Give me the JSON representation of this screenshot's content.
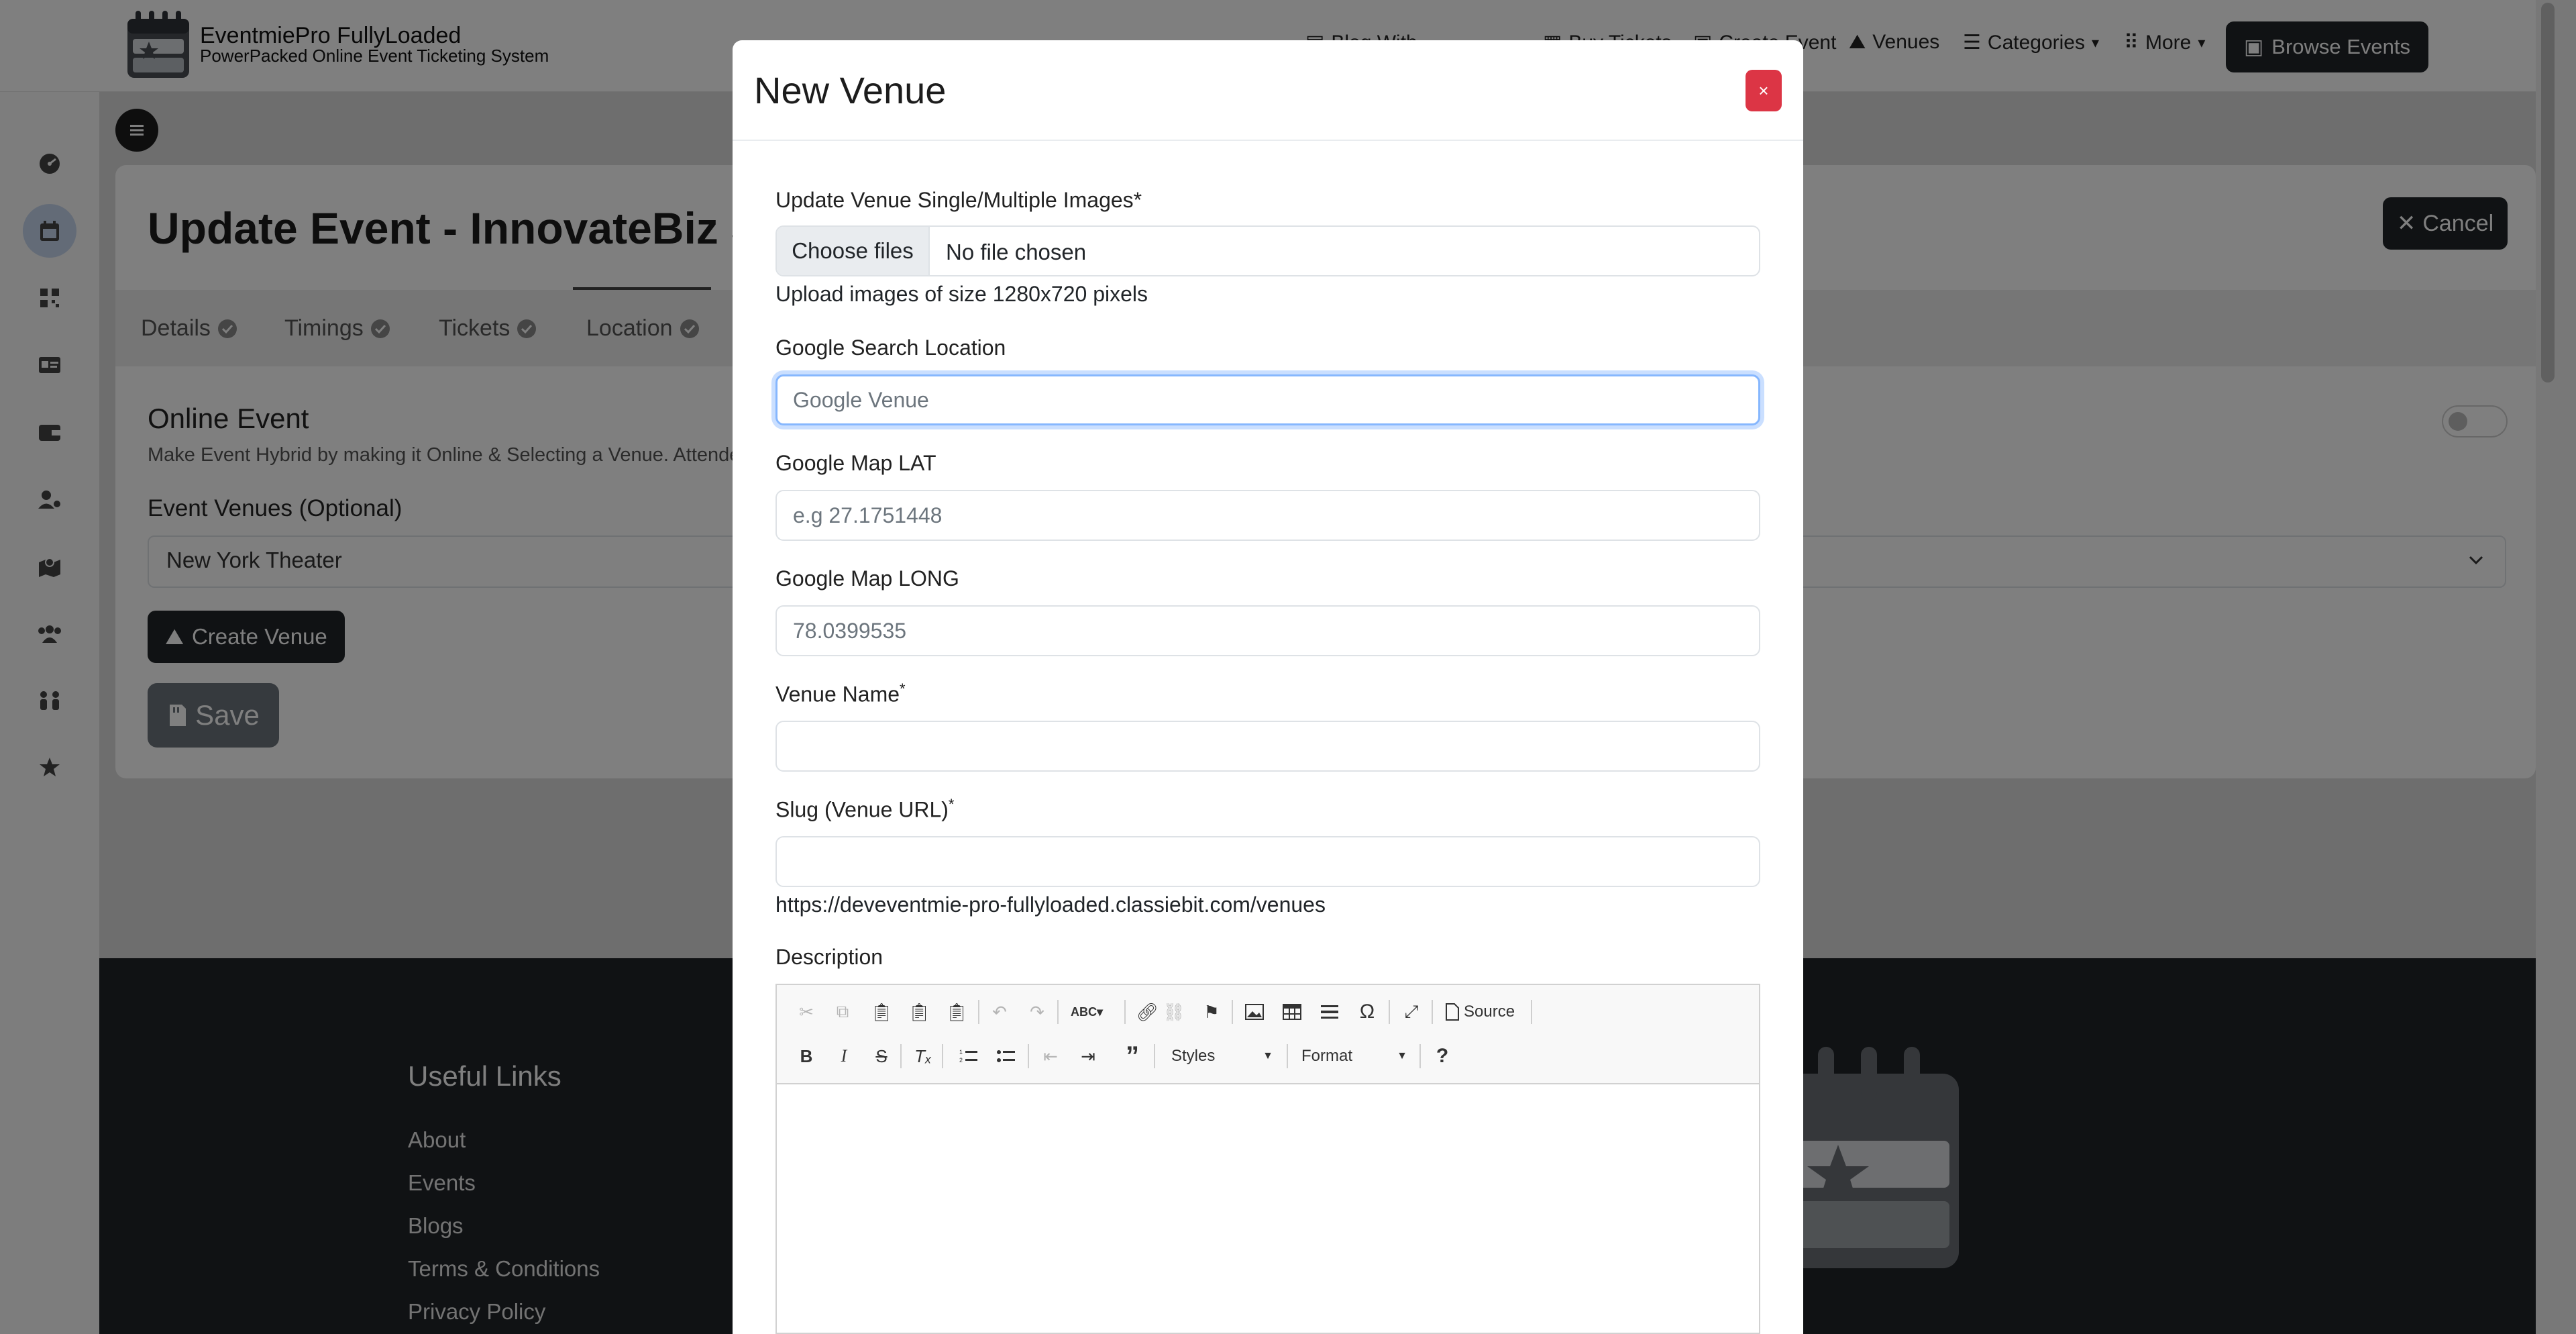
{
  "brand": {
    "name": "EventmiePro FullyLoaded",
    "tagline": "PowerPacked Online Event Ticketing System"
  },
  "navbar": {
    "items": [
      {
        "label": "Blog With"
      },
      {
        "label": "Buy Tickets"
      },
      {
        "label": "Create Event"
      },
      {
        "label": "Venues"
      },
      {
        "label": "Categories"
      },
      {
        "label": "More"
      }
    ],
    "browse_events": "Browse Events"
  },
  "page": {
    "title": "Update Event - InnovateBiz Su",
    "cancel_label": "Cancel",
    "tabs": [
      {
        "label": "Details"
      },
      {
        "label": "Timings"
      },
      {
        "label": "Tickets"
      },
      {
        "label": "Location"
      }
    ],
    "online_event": {
      "title": "Online Event",
      "description": "Make Event Hybrid by making it Online & Selecting a Venue. Attende"
    },
    "venues": {
      "label": "Event Venues (Optional)",
      "selected": "New York Theater"
    },
    "create_venue_label": "Create Venue",
    "save_label": "Save"
  },
  "footer": {
    "heading": "Useful Links",
    "links": [
      "About",
      "Events",
      "Blogs",
      "Terms & Conditions",
      "Privacy Policy"
    ]
  },
  "modal": {
    "title": "New Venue",
    "close_label": "×",
    "images": {
      "label": "Update Venue Single/Multiple Images*",
      "button": "Choose files",
      "status": "No file chosen",
      "help": "Upload images of size 1280x720 pixels"
    },
    "google_search": {
      "label": "Google Search Location",
      "placeholder": "Google Venue"
    },
    "lat": {
      "label": "Google Map LAT",
      "placeholder": "e.g 27.1751448"
    },
    "long": {
      "label": "Google Map LONG",
      "placeholder": "78.0399535"
    },
    "venue_name": {
      "label": "Venue Name",
      "required_mark": "*"
    },
    "slug": {
      "label": "Slug (Venue URL)",
      "required_mark": "*",
      "help": "https://deveventmie-pro-fullyloaded.classiebit.com/venues"
    },
    "description": {
      "label": "Description"
    },
    "editor": {
      "source_label": "Source",
      "styles_label": "Styles",
      "format_label": "Format",
      "spell_label": "ABC",
      "special_char": "Ω",
      "help_glyph": "?",
      "bold_glyph": "B",
      "italic_glyph": "I",
      "strike_glyph": "S",
      "quote_glyph": "”"
    }
  },
  "colors": {
    "primary_dark": "#212529",
    "danger": "#dc3545",
    "secondary": "#6c757d",
    "focus": "#86b7fe"
  }
}
